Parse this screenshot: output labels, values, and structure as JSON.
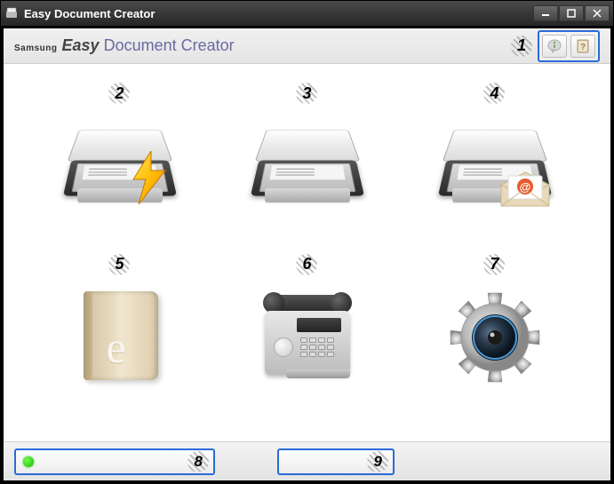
{
  "window": {
    "title": "Easy Document Creator"
  },
  "header": {
    "brand_prefix": "Samsung",
    "brand_bold": "Easy",
    "brand_rest": "Document Creator"
  },
  "callouts": {
    "c1": "1",
    "c2": "2",
    "c3": "3",
    "c4": "4",
    "c5": "5",
    "c6": "6",
    "c7": "7",
    "c8": "8",
    "c9": "9"
  },
  "icons": {
    "info": "info-icon",
    "help": "help-icon",
    "quick_scan": "quick-scan-icon",
    "scan": "scan-icon",
    "scan_email": "scan-to-email-icon",
    "ebook": "ebook-icon",
    "fax": "fax-icon",
    "settings": "settings-gear-icon",
    "status_online": "status-online-icon"
  },
  "footer": {
    "status_label": "",
    "right_label": ""
  }
}
